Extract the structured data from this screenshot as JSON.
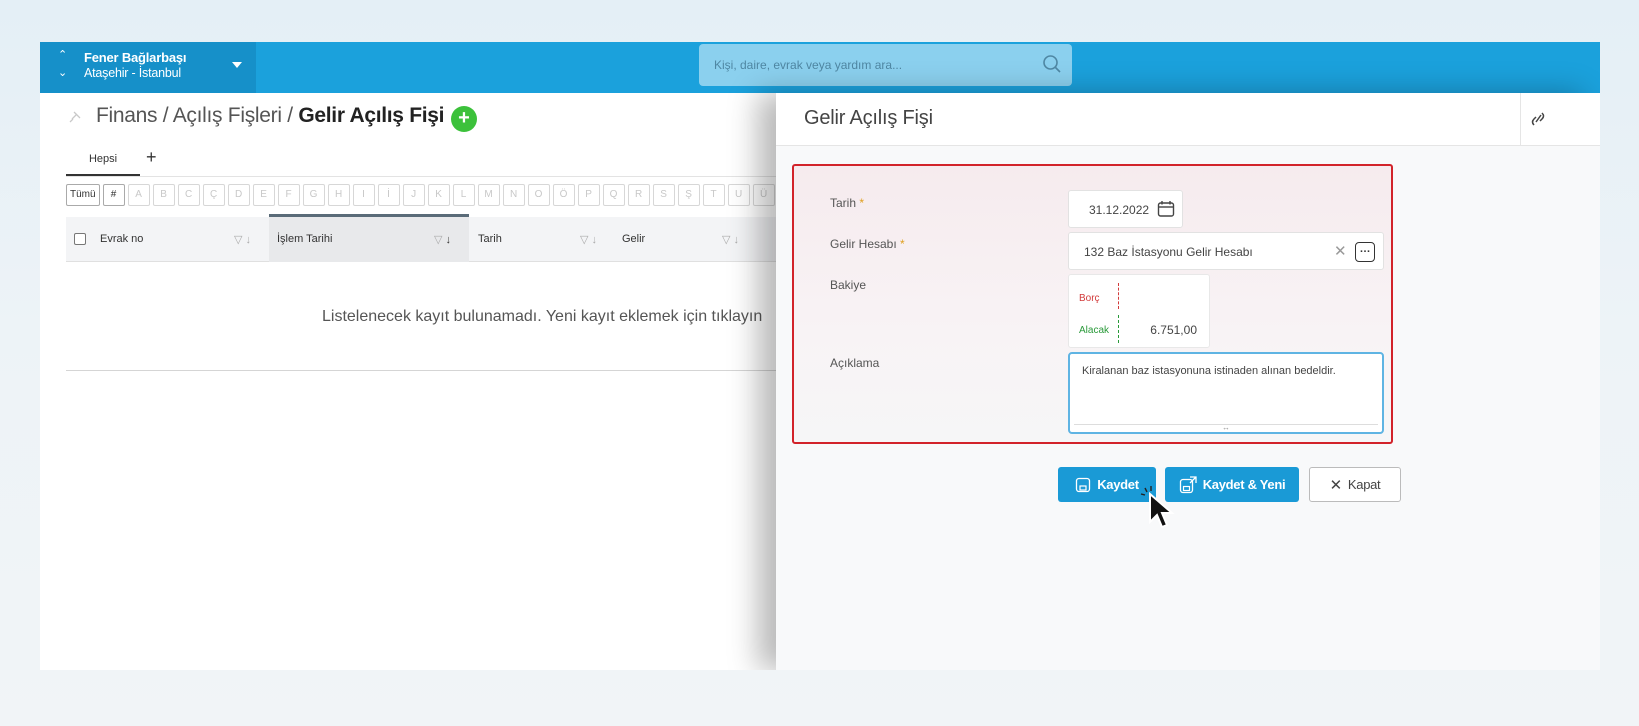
{
  "org": {
    "name": "Fener Bağlarbaşı",
    "location": "Ataşehir - İstanbul"
  },
  "search": {
    "placeholder": "Kişi, daire, evrak veya yardım ara..."
  },
  "breadcrumb": {
    "part1": "Finans",
    "sep": "/",
    "part2": "Açılış Fişleri",
    "current": "Gelir Açılış Fişi"
  },
  "add_button": "+",
  "tabs": {
    "all": "Hepsi",
    "add": "+"
  },
  "alphabet": [
    "Tümü",
    "#",
    "A",
    "B",
    "C",
    "Ç",
    "D",
    "E",
    "F",
    "G",
    "H",
    "I",
    "İ",
    "J",
    "K",
    "L",
    "M",
    "N",
    "O",
    "Ö",
    "P",
    "Q",
    "R",
    "S",
    "Ş",
    "T",
    "U",
    "Ü"
  ],
  "table": {
    "columns": [
      "Evrak no",
      "İşlem Tarihi",
      "Tarih",
      "Gelir"
    ],
    "empty_message": "Listelenecek kayıt bulunamadı. Yeni kayıt eklemek için tıklayın"
  },
  "panel": {
    "title": "Gelir Açılış Fişi",
    "fields": {
      "date_label": "Tarih",
      "date_value": "31.12.2022",
      "account_label": "Gelir Hesabı",
      "account_value": "132 Baz İstasyonu Gelir Hesabı",
      "balance_label": "Bakiye",
      "debit_label": "Borç",
      "credit_label": "Alacak",
      "credit_value": "6.751,00",
      "desc_label": "Açıklama",
      "desc_value": "Kiralanan baz istasyonuna istinaden alınan bedeldir.",
      "required_mark": "*"
    },
    "buttons": {
      "save": "Kaydet",
      "save_new": "Kaydet & Yeni",
      "close": "Kapat"
    }
  },
  "colors": {
    "topbar": "#1ba1dc",
    "primary_button": "#1a9ad6",
    "error_border": "#d2232a",
    "add_green": "#3cc13b"
  }
}
